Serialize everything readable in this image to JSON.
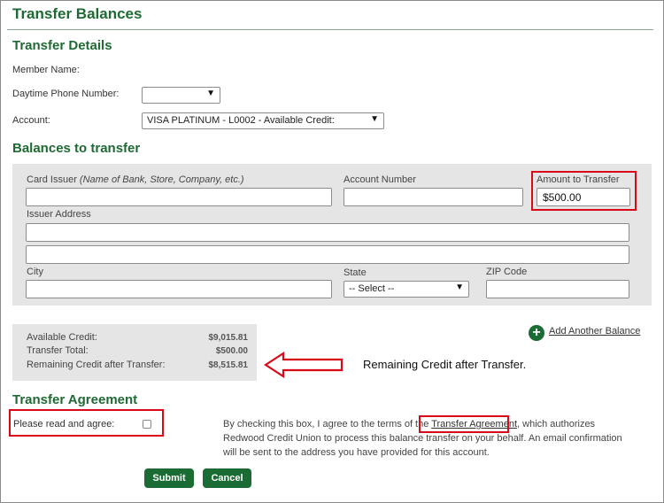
{
  "page_title": "Transfer Balances",
  "details": {
    "title": "Transfer Details",
    "member_name_label": "Member Name:",
    "phone_label": "Daytime Phone Number:",
    "phone_value": "",
    "account_label": "Account:",
    "account_value": "VISA PLATINUM - L0002 - Available Credit:"
  },
  "balances": {
    "title": "Balances to transfer",
    "card_issuer_label": "Card Issuer",
    "card_issuer_hint": "(Name of Bank, Store, Company, etc.)",
    "account_number_label": "Account Number",
    "amount_label": "Amount to Transfer",
    "amount_value": "$500.00",
    "issuer_address_label": "Issuer Address",
    "city_label": "City",
    "state_label": "State",
    "state_value": "-- Select --",
    "zip_label": "ZIP Code"
  },
  "summary": {
    "available_label": "Available Credit:",
    "available_value": "$9,015.81",
    "total_label": "Transfer Total:",
    "total_value": "$500.00",
    "remaining_label": "Remaining Credit after Transfer:",
    "remaining_value": "$8,515.81"
  },
  "add_balance_label": "Add Another Balance",
  "annotation_text": "Remaining Credit after Transfer.",
  "agreement": {
    "title": "Transfer Agreement",
    "read_label": "Please read and agree:",
    "text_before": "By checking this box, I agree to the terms of the ",
    "link_text": "Transfer Agreement",
    "text_after": ", which authorizes Redwood Credit Union to process this balance transfer on your behalf. An email confirmation will be sent to the address you have provided for this account."
  },
  "buttons": {
    "submit": "Submit",
    "cancel": "Cancel"
  },
  "icons": {
    "dropdown": "▼",
    "add": "+"
  },
  "colors": {
    "brand_green": "#1a6b34",
    "heading_green": "#1f6a34",
    "highlight_red": "#d9091a"
  }
}
